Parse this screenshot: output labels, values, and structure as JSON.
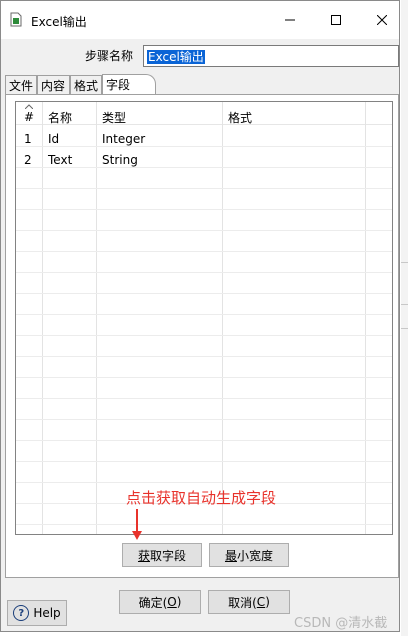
{
  "window": {
    "title": "Excel输出"
  },
  "step": {
    "label": "步骤名称",
    "value": "Excel输出"
  },
  "tabs": [
    {
      "label": "文件",
      "active": false
    },
    {
      "label": "内容",
      "active": false
    },
    {
      "label": "格式",
      "active": false
    },
    {
      "label": "字段",
      "active": true
    }
  ],
  "table": {
    "columns": [
      "#",
      "名称",
      "类型",
      "格式"
    ],
    "rows": [
      {
        "num": "1",
        "name": "Id",
        "type": "Integer",
        "format": ""
      },
      {
        "num": "2",
        "name": "Text",
        "type": "String",
        "format": ""
      }
    ]
  },
  "buttons": {
    "get_fields": {
      "pre": "",
      "key": "获",
      "post": "取字段"
    },
    "min_width": {
      "pre": "",
      "key": "最",
      "post": "小宽度"
    },
    "ok": {
      "pre": "确定(",
      "key": "O",
      "post": ")"
    },
    "cancel": {
      "pre": "取消(",
      "key": "C",
      "post": ")"
    },
    "help": "Help"
  },
  "annotation": {
    "text": "点击获取自动生成字段",
    "color": "#e8322b"
  },
  "watermark": "CSDN @清水截",
  "colors": {
    "selection": "#0a64d6",
    "window_bg": "#f0f0f0"
  }
}
